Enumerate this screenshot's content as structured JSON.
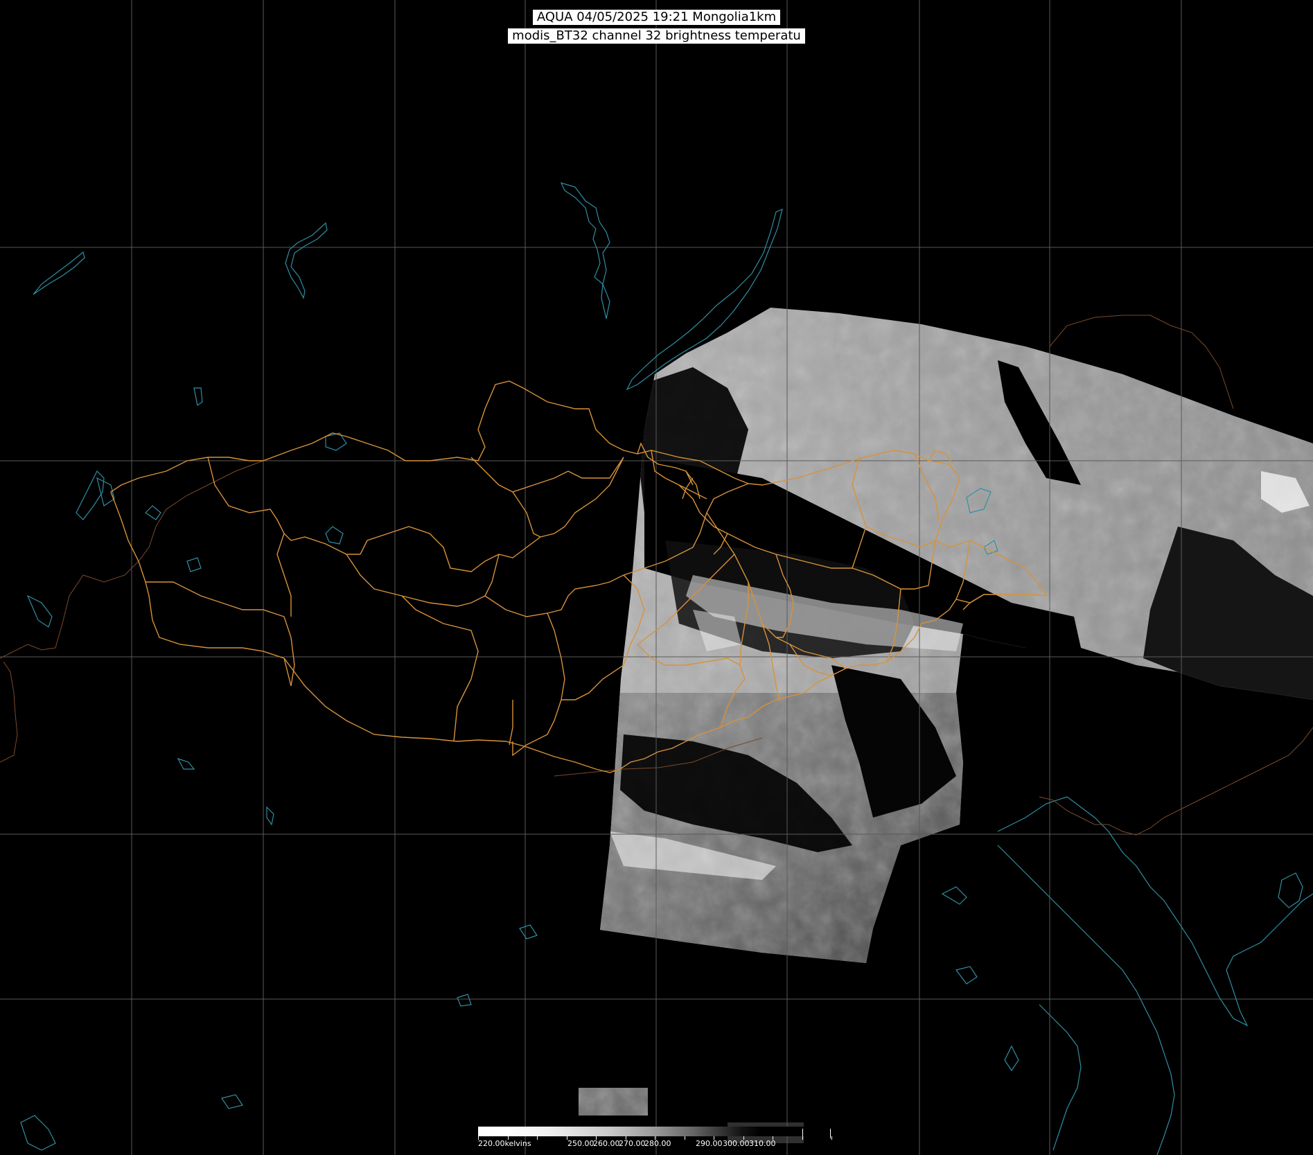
{
  "title": {
    "line1": "AQUA 04/05/2025 19:21 Mongolia1km",
    "line2": "modis_BT32 channel 32 brightness temperatu"
  },
  "colorbar": {
    "labels": [
      "220.00kelvins",
      "250.00",
      "260.00",
      "270.00",
      "280.00",
      "290.00",
      "300.00",
      "310.00"
    ],
    "min_value": 220,
    "max_value": 320
  },
  "colors": {
    "background": "#000000",
    "graticule": "#5a5a5a",
    "admin_boundary": "#d8923a",
    "coastline_water": "#2f8fa3",
    "country_border_faint": "#7a4a2a"
  }
}
